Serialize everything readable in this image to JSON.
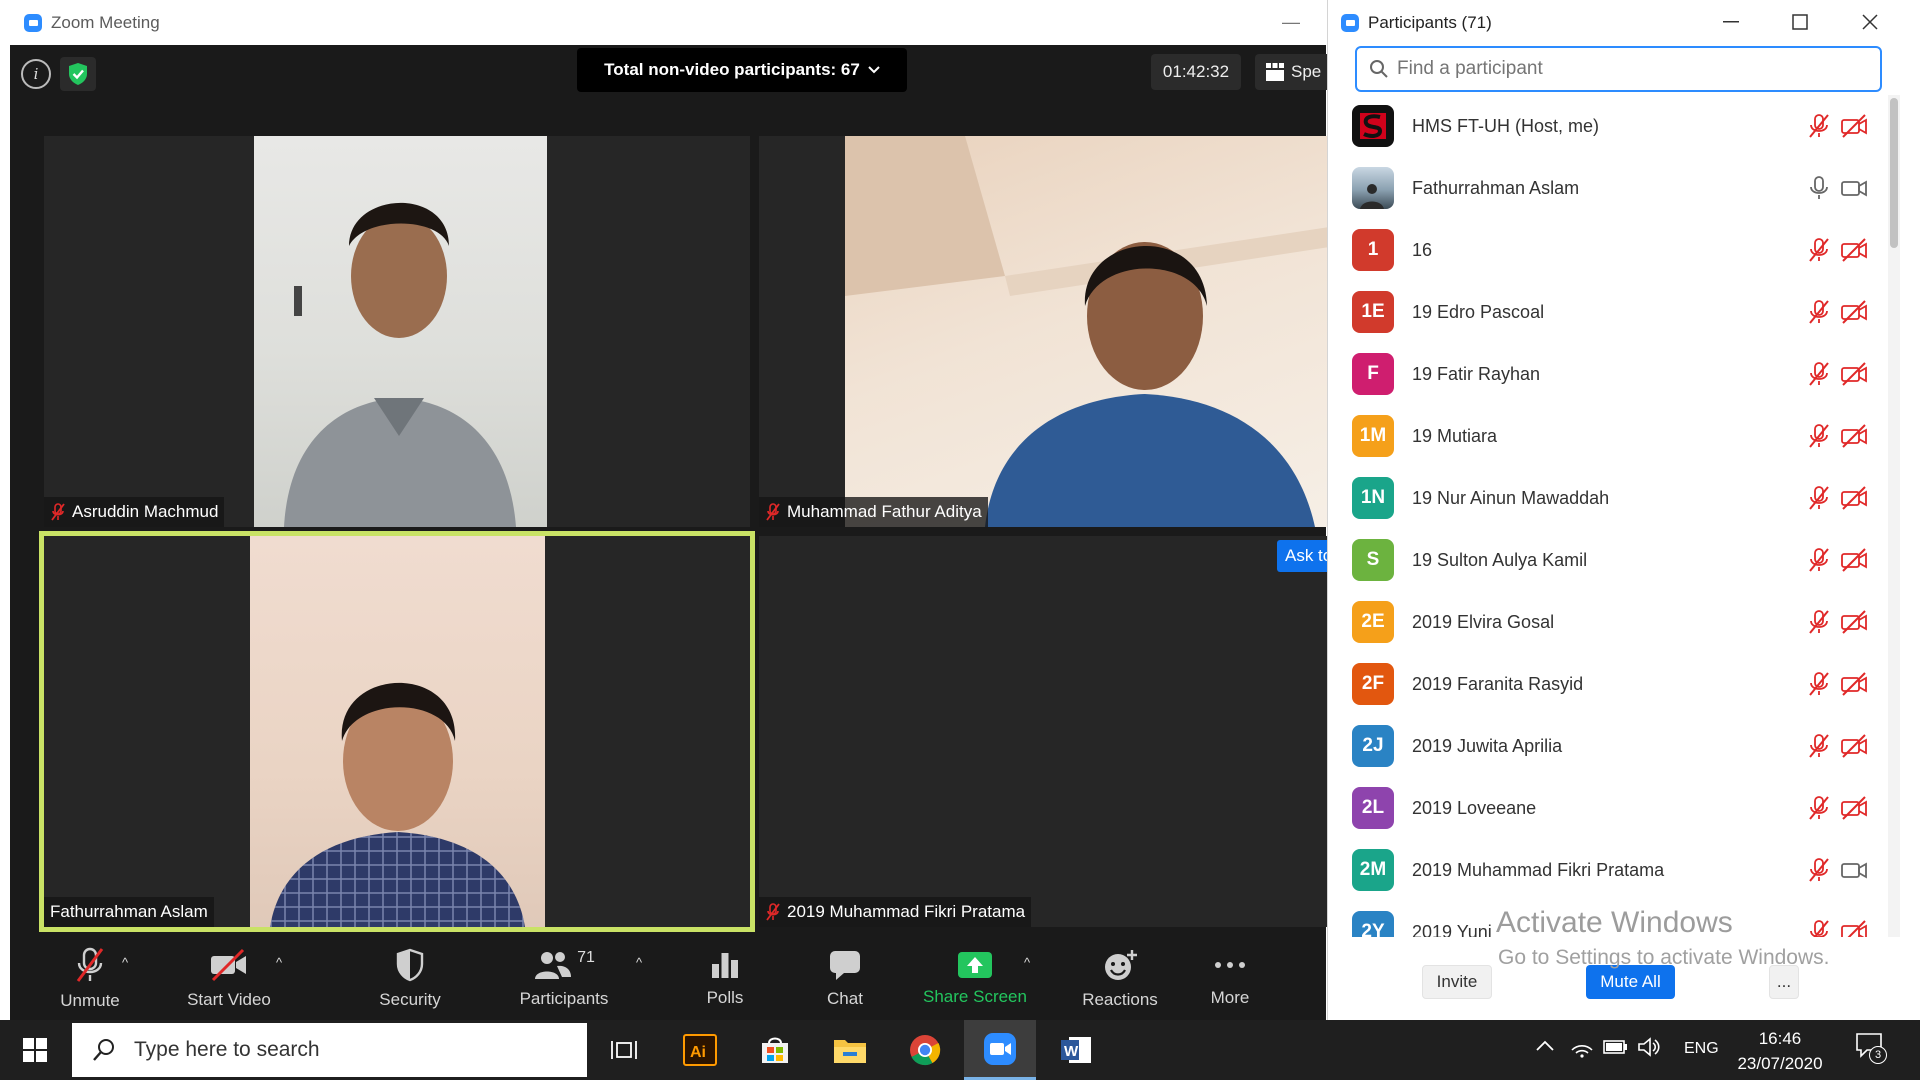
{
  "zoom": {
    "window_title": "Zoom Meeting",
    "non_video_label": "Total non-video participants: 67",
    "timer": "01:42:32",
    "view_label": "Spe",
    "ask_button": "Ask to",
    "tiles": [
      {
        "name": "Asruddin Machmud",
        "muted": true,
        "video": true
      },
      {
        "name": "Muhammad Fathur Aditya",
        "muted": true,
        "video": true
      },
      {
        "name": "Fathurrahman Aslam",
        "muted": false,
        "video": true,
        "active_speaker": true
      },
      {
        "name": "2019 Muhammad Fikri Pratama",
        "muted": true,
        "video": false
      }
    ],
    "toolbar": {
      "unmute": "Unmute",
      "start_video": "Start Video",
      "security": "Security",
      "participants": "Participants",
      "participants_count": "71",
      "polls": "Polls",
      "chat": "Chat",
      "share_screen": "Share Screen",
      "reactions": "Reactions",
      "more": "More"
    }
  },
  "participants_panel": {
    "title": "Participants (71)",
    "search_placeholder": "Find a participant",
    "participants": [
      {
        "name": "HMS FT-UH (Host, me)",
        "avatar": "logo",
        "color": "#d0021b",
        "mic": "muted",
        "cam": "off"
      },
      {
        "name": "Fathurrahman Aslam",
        "avatar": "photo",
        "color": "#6b7a86",
        "mic": "on",
        "cam": "on"
      },
      {
        "name": "16",
        "avatar": "1",
        "color": "#d13a2c",
        "mic": "muted",
        "cam": "off"
      },
      {
        "name": "19 Edro Pascoal",
        "avatar": "1E",
        "color": "#d13a2c",
        "mic": "muted",
        "cam": "off"
      },
      {
        "name": "19 Fatir Rayhan",
        "avatar": "F",
        "color": "#cf1e6f",
        "mic": "muted",
        "cam": "off"
      },
      {
        "name": "19 Mutiara",
        "avatar": "1M",
        "color": "#f5a01a",
        "mic": "muted",
        "cam": "off"
      },
      {
        "name": "19 Nur Ainun Mawaddah",
        "avatar": "1N",
        "color": "#1aa58a",
        "mic": "muted",
        "cam": "off"
      },
      {
        "name": "19 Sulton Aulya Kamil",
        "avatar": "S",
        "color": "#6cb33f",
        "mic": "muted",
        "cam": "off"
      },
      {
        "name": "2019 Elvira Gosal",
        "avatar": "2E",
        "color": "#f5a01a",
        "mic": "muted",
        "cam": "off"
      },
      {
        "name": "2019 Faranita Rasyid",
        "avatar": "2F",
        "color": "#e2570f",
        "mic": "muted",
        "cam": "off"
      },
      {
        "name": "2019 Juwita Aprilia",
        "avatar": "2J",
        "color": "#2a83c4",
        "mic": "muted",
        "cam": "off"
      },
      {
        "name": "2019 Loveeane",
        "avatar": "2L",
        "color": "#8e44ad",
        "mic": "muted",
        "cam": "off"
      },
      {
        "name": "2019 Muhammad Fikri Pratama",
        "avatar": "2M",
        "color": "#1aa58a",
        "mic": "muted",
        "cam": "on"
      },
      {
        "name": "2019 Yuni",
        "avatar": "2Y",
        "color": "#2a83c4",
        "mic": "muted",
        "cam": "off"
      }
    ],
    "invite": "Invite",
    "mute_all": "Mute All",
    "more": "..."
  },
  "watermark": {
    "line1": "Activate Windows",
    "line2": "Go to Settings to activate Windows."
  },
  "taskbar": {
    "search_placeholder": "Type here to search",
    "language": "ENG",
    "time": "16:46",
    "date": "23/07/2020",
    "notification_count": "3"
  }
}
